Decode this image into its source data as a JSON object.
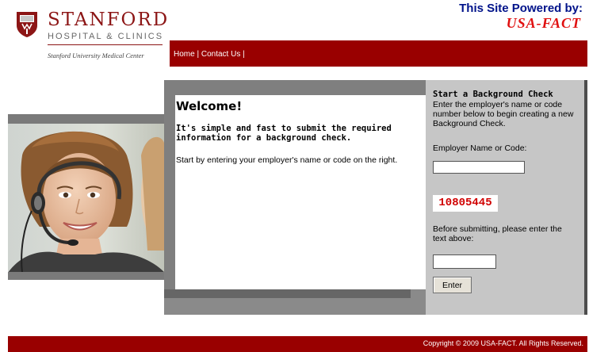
{
  "header": {
    "logo_title": "STANFORD",
    "logo_subtitle": "HOSPITAL & CLINICS",
    "logo_tagline": "Stanford University Medical Center",
    "powered_by_line1": "This Site Powered by:",
    "powered_by_line2": "USA-FACT"
  },
  "nav": {
    "links": [
      "Home",
      "Contact Us"
    ],
    "separator": "|"
  },
  "welcome": {
    "title": "Welcome!",
    "intro": "It's simple and fast to submit the required information for a background check.",
    "start_text": "Start by entering your employer's name or code on the right."
  },
  "panel": {
    "title": "Start a Background Check",
    "instructions": "Enter the employer's name or code number below to begin creating a new Background Check.",
    "employer_label": "Employer Name or Code:",
    "employer_value": "",
    "captcha_text": "10805445",
    "submit_label": "Before submitting, please enter the text above:",
    "captcha_value": "",
    "enter_button": "Enter"
  },
  "footer": {
    "copyright": "Copyright © 2009 USA-FACT. All Rights Reserved."
  },
  "colors": {
    "brand_red": "#990000",
    "stanford_red": "#8c1515",
    "powered_blue": "#00138a",
    "usa_fact_red": "#e01010",
    "panel_gray": "#c6c6c6"
  },
  "icons": {
    "logo": "stanford-shield-icon",
    "photo": "call-center-agent-photo"
  }
}
